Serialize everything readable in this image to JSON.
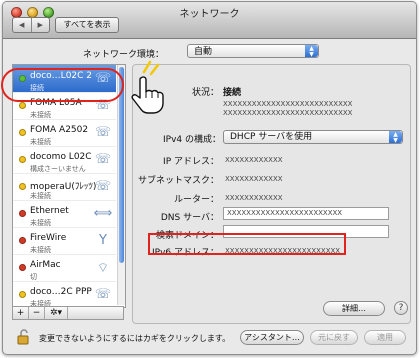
{
  "window": {
    "title": "ネットワーク",
    "back": "◀",
    "forward": "▶",
    "show_all": "すべてを表示"
  },
  "location": {
    "label": "ネットワーク環境：",
    "value": "自動"
  },
  "services": [
    {
      "name": "doco…L02C 2",
      "status": "接続",
      "dot": "green",
      "icon": "phone-icon",
      "selected": true
    },
    {
      "name": "FOMA L05A",
      "status": "未接続",
      "dot": "yellow",
      "icon": "phone-icon",
      "selected": false
    },
    {
      "name": "FOMA A2502",
      "status": "未接続",
      "dot": "yellow",
      "icon": "phone-icon",
      "selected": false
    },
    {
      "name": "docomo L02C",
      "status": "構成さーいません",
      "dot": "yellow",
      "icon": "phone-icon",
      "selected": false
    },
    {
      "name": "moperaU(ﾌﾚｯﾂ)",
      "status": "未接続",
      "dot": "yellow",
      "icon": "phone-icon",
      "selected": false
    },
    {
      "name": "Ethernet",
      "status": "未接続",
      "dot": "red",
      "icon": "ethernet-icon",
      "selected": false
    },
    {
      "name": "FireWire",
      "status": "未接続",
      "dot": "red",
      "icon": "firewire-icon",
      "selected": false
    },
    {
      "name": "AirMac",
      "status": "切",
      "dot": "red",
      "icon": "wifi-icon",
      "selected": false
    },
    {
      "name": "doco…2C PPP",
      "status": "未接続",
      "dot": "yellow",
      "icon": "phone-icon",
      "selected": false
    }
  ],
  "sidebar_tools": {
    "add": "+",
    "remove": "−",
    "action": "✲▾"
  },
  "details": {
    "status_label": "状況：",
    "status_value": "接続",
    "status_detail_1": "XXXXXXXXXXXXXXXXXXXXXXXXXXX",
    "status_detail_2": "XXXXXXXXXXXXXXXXXXXXXXXXXXX",
    "ipv4_label": "IPv4 の構成：",
    "ipv4_value": "DHCP サーバを使用",
    "ip_label": "IP アドレス：",
    "ip_value": "XXXXXXXXXXXX",
    "subnet_label": "サブネットマスク：",
    "subnet_value": "XXXXXXXXXXXX",
    "router_label": "ルーター：",
    "router_value": "XXXXXXXXXXXX",
    "dns_label": "DNS サーバ：",
    "dns_value": "XXXXXXXXXXXXXXXXXXXXXXXX",
    "search_label": "検索ドメイン：",
    "search_value": "",
    "ipv6_label": "IPv6 アドレス：",
    "ipv6_value": "XXXXXXXXXXXXXXXXXXXXXXXX",
    "advanced_button": "詳細…",
    "help_button": "?"
  },
  "footer": {
    "lock_text": "変更できないようにするにはカギをクリックします。",
    "assistant_button": "アシスタント…",
    "revert_button": "元に戻す",
    "apply_button": "適用"
  },
  "colors": {
    "highlight": "#e0231c",
    "selection": "#2d6bcc"
  }
}
